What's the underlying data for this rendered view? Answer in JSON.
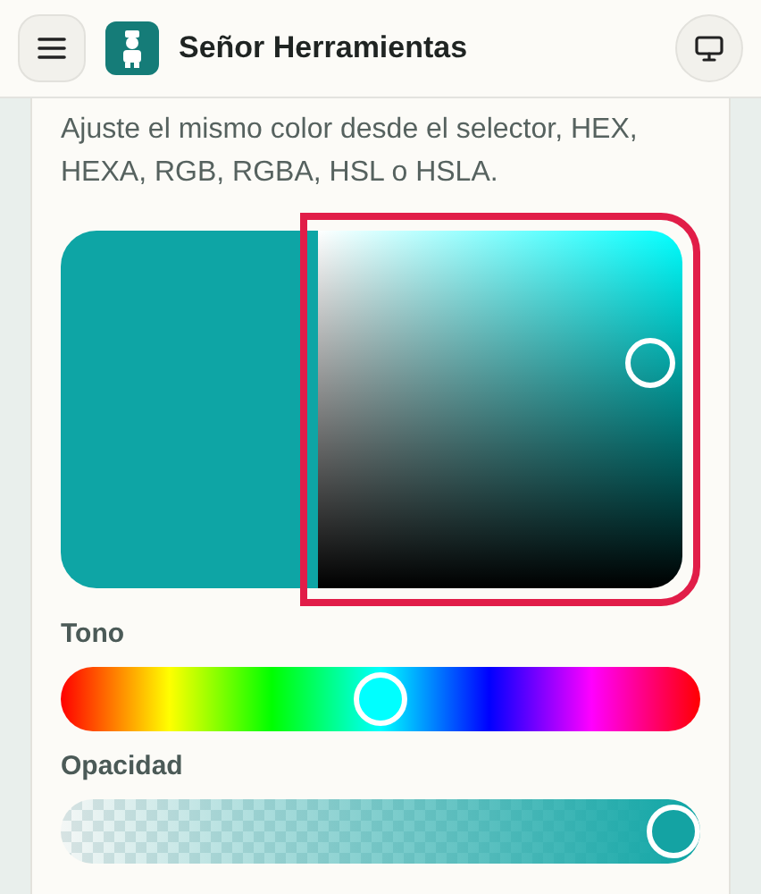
{
  "header": {
    "title": "Señor Herramientas"
  },
  "intro": "Ajuste el mismo color desde el selector, HEX, HEXA, RGB, RGBA, HSL o HSLA.",
  "picker": {
    "highlighted": true
  },
  "sliders": [
    {
      "kind": "hue",
      "label": "Tono",
      "level": 0.5
    },
    {
      "kind": "opacity",
      "label": "Opacidad",
      "level": 1
    }
  ]
}
